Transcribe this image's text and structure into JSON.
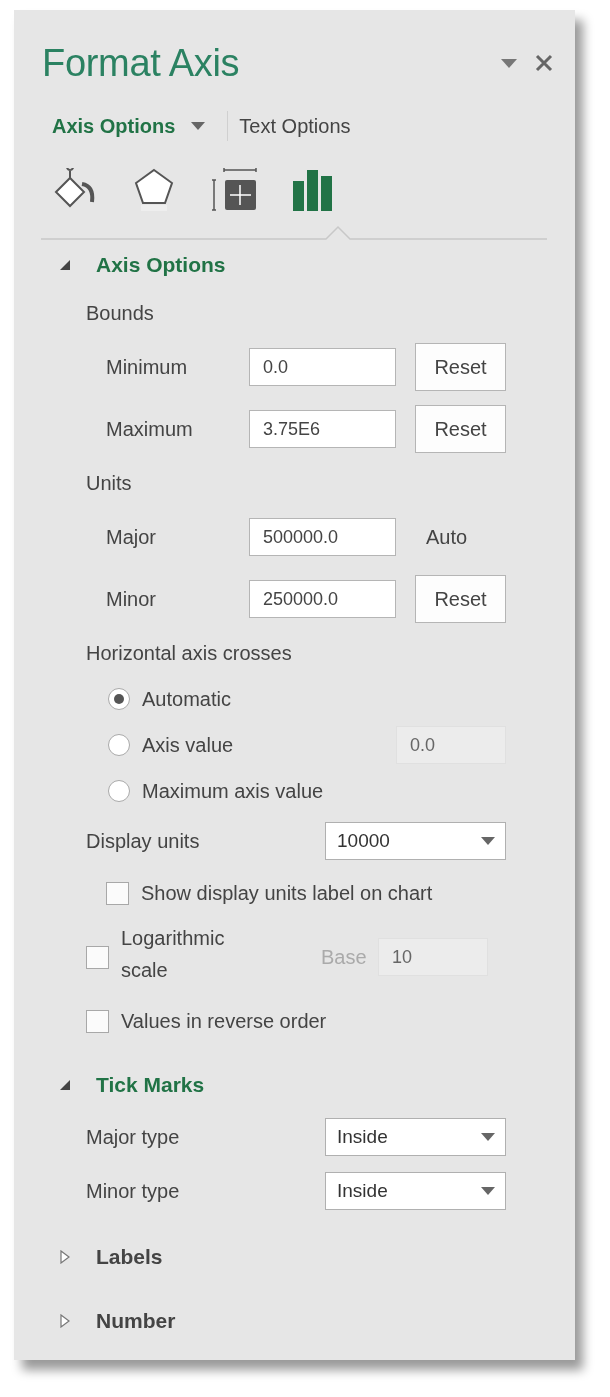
{
  "panel": {
    "title": "Format Axis"
  },
  "option_tabs": [
    {
      "label": "Axis Options",
      "selected": true,
      "has_menu": true
    },
    {
      "label": "Text Options",
      "selected": false,
      "has_menu": false
    }
  ],
  "category_icons": [
    {
      "kind": "fill",
      "selected": false
    },
    {
      "kind": "effects",
      "selected": false
    },
    {
      "kind": "size",
      "selected": false
    },
    {
      "kind": "options",
      "selected": true
    }
  ],
  "sections": [
    {
      "title": "Axis Options",
      "expanded": true,
      "items": [
        {
          "kind": "heading",
          "label": "Bounds"
        },
        {
          "kind": "field",
          "label": "Minimum",
          "value": "0.0",
          "action": {
            "kind": "button",
            "label": "Reset"
          }
        },
        {
          "kind": "field",
          "label": "Maximum",
          "value": "3.75E6",
          "action": {
            "kind": "button",
            "label": "Reset"
          }
        },
        {
          "kind": "heading",
          "label": "Units"
        },
        {
          "kind": "field",
          "label": "Major",
          "value": "500000.0",
          "action": {
            "kind": "text",
            "label": "Auto"
          }
        },
        {
          "kind": "field",
          "label": "Minor",
          "value": "250000.0",
          "action": {
            "kind": "button",
            "label": "Reset"
          }
        },
        {
          "kind": "heading",
          "label": "Horizontal axis crosses"
        },
        {
          "kind": "radio",
          "label": "Automatic",
          "selected": true
        },
        {
          "kind": "radio",
          "label": "Axis value",
          "selected": false,
          "field": {
            "value": "0.0",
            "disabled": true
          }
        },
        {
          "kind": "radio",
          "label": "Maximum axis value",
          "selected": false
        },
        {
          "kind": "select",
          "label": "Display units",
          "value": "10000"
        },
        {
          "kind": "sub_checkbox",
          "label": "Show display units label on chart",
          "checked": false
        },
        {
          "kind": "checkbox_base",
          "label": "Logarithmic scale",
          "checked": false,
          "base_label": "Base",
          "field": {
            "value": "10",
            "disabled": true
          }
        },
        {
          "kind": "checkbox",
          "label": "Values in reverse order",
          "checked": false
        }
      ]
    },
    {
      "title": "Tick Marks",
      "expanded": true,
      "items": [
        {
          "kind": "select",
          "label": "Major type",
          "value": "Inside"
        },
        {
          "kind": "select",
          "label": "Minor type",
          "value": "Inside"
        }
      ]
    },
    {
      "title": "Labels",
      "expanded": false
    },
    {
      "title": "Number",
      "expanded": false
    }
  ]
}
